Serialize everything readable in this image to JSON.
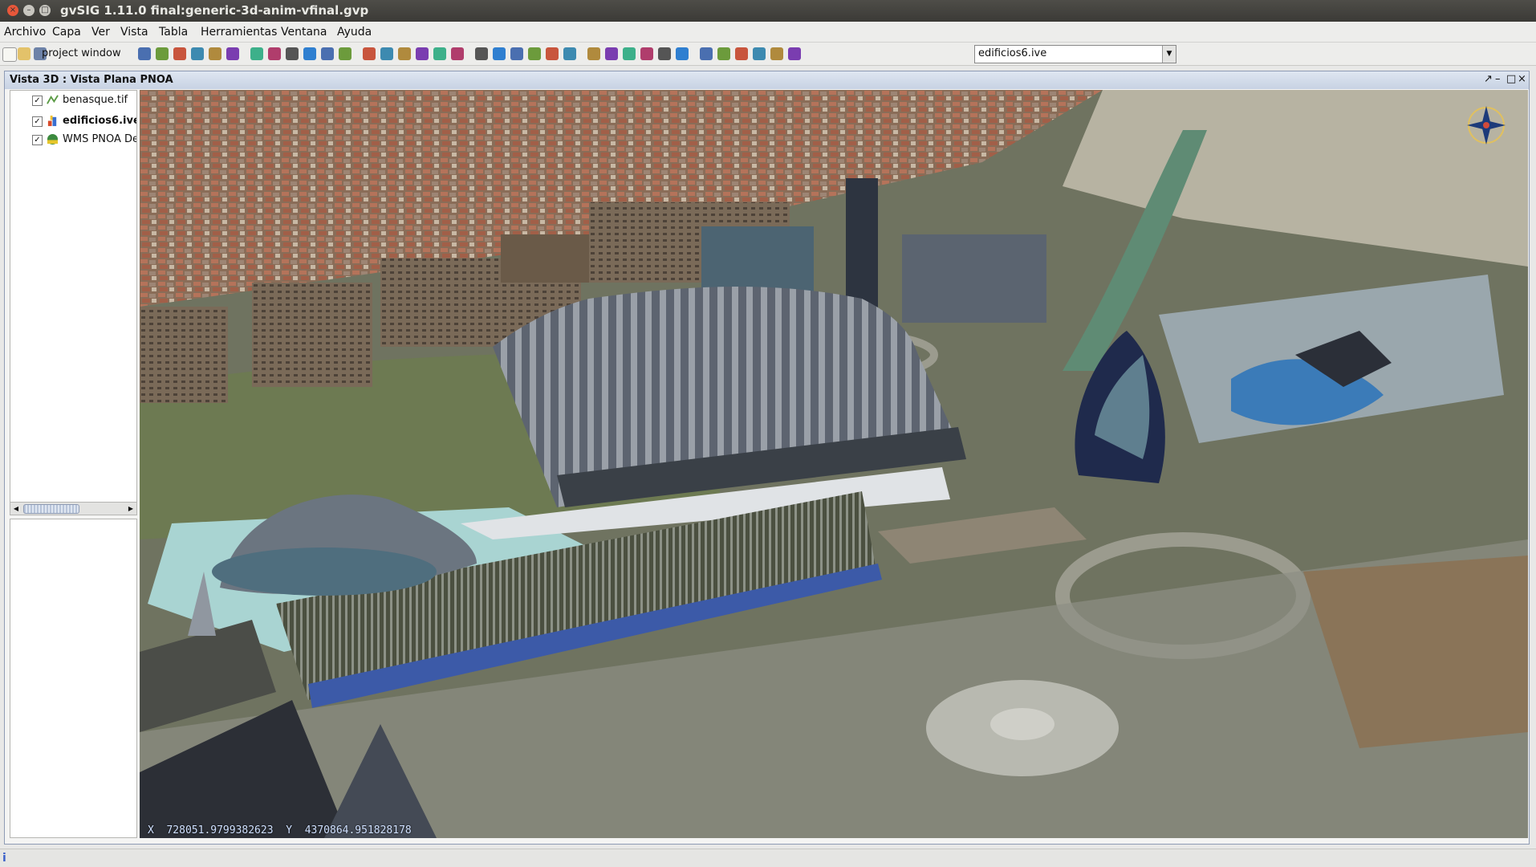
{
  "window": {
    "title": "gvSIG 1.11.0 final:generic-3d-anim-vfinal.gvp"
  },
  "menu": [
    "Archivo",
    "Capa",
    "Ver",
    "Vista",
    "Tabla",
    "Herramientas",
    "Ventana",
    "Ayuda"
  ],
  "toolbar": {
    "project_window_label": "project window",
    "layer_select_value": "edificios6.ive"
  },
  "view": {
    "title": "Vista 3D : Vista Plana PNOA",
    "layers": [
      {
        "name": "benasque.tif",
        "checked": true,
        "bold": false,
        "icon": "raster-layer-icon"
      },
      {
        "name": "edificios6.ive",
        "checked": true,
        "bold": true,
        "icon": "3d-model-layer-icon"
      },
      {
        "name": "WMS PNOA De",
        "checked": true,
        "bold": false,
        "icon": "wms-layer-icon"
      }
    ],
    "coordinates": {
      "x_label": "X",
      "x_value": "728051.9799382623",
      "y_label": "Y",
      "y_value": "4370864.951828178"
    }
  },
  "status": {
    "icon_text": "i"
  },
  "colors": {
    "accent": "#3a5fc9",
    "titlebar": "#3b3a36",
    "frame_title": "#c7d2e3"
  }
}
